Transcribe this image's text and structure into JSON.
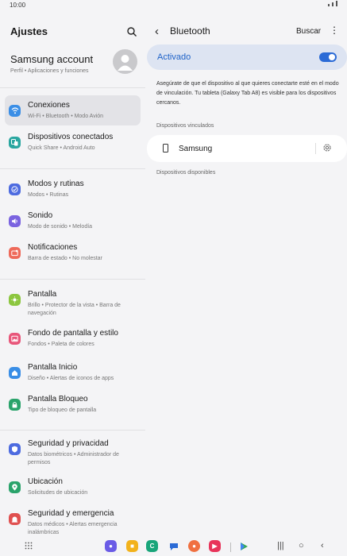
{
  "status_bar": {
    "time": "10:00"
  },
  "left": {
    "title": "Ajustes",
    "account": {
      "name": "Samsung account",
      "sub": "Perfil • Aplicaciones y funciones"
    },
    "items": [
      {
        "title": "Conexiones",
        "sub": "Wi-Fi • Bluetooth • Modo Avión",
        "color": "#3a8ee6",
        "icon": "wifi-icon"
      },
      {
        "title": "Dispositivos conectados",
        "sub": "Quick Share • Android Auto",
        "color": "#2aa6a0",
        "icon": "devices-icon"
      },
      {
        "title": "Modos y rutinas",
        "sub": "Modos • Rutinas",
        "color": "#4d6be0",
        "icon": "check-circle-icon"
      },
      {
        "title": "Sonido",
        "sub": "Modo de sonido • Melodía",
        "color": "#7a63e0",
        "icon": "speaker-icon"
      },
      {
        "title": "Notificaciones",
        "sub": "Barra de estado • No molestar",
        "color": "#ee6a5a",
        "icon": "bell-icon"
      },
      {
        "title": "Pantalla",
        "sub": "Brillo • Protector de la vista • Barra de navegación",
        "color": "#8cc63f",
        "icon": "sun-icon"
      },
      {
        "title": "Fondo de pantalla y estilo",
        "sub": "Fondos • Paleta de colores",
        "color": "#e8567a",
        "icon": "image-icon"
      },
      {
        "title": "Pantalla Inicio",
        "sub": "Diseño • Alertas de iconos de apps",
        "color": "#3a8ee6",
        "icon": "home-icon"
      },
      {
        "title": "Pantalla Bloqueo",
        "sub": "Tipo de bloqueo de pantalla",
        "color": "#2aa36b",
        "icon": "lock-icon"
      },
      {
        "title": "Seguridad y privacidad",
        "sub": "Datos biométricos • Administrador de permisos",
        "color": "#4d6be0",
        "icon": "shield-icon"
      },
      {
        "title": "Ubicación",
        "sub": "Solicitudes de ubicación",
        "color": "#2aa36b",
        "icon": "location-pin-icon"
      },
      {
        "title": "Seguridad y emergencia",
        "sub": "Datos médicos • Alertas emergencia inalámbricas",
        "color": "#e05050",
        "icon": "emergency-icon"
      }
    ]
  },
  "right": {
    "title": "Bluetooth",
    "search_label": "Buscar",
    "toggle": {
      "label": "Activado",
      "on": true
    },
    "info": "Asegúrate de que el dispositivo al que quieres conectarte esté en el modo de vinculación. Tu tableta (Galaxy Tab A8) es visible para los dispositivos cercanos.",
    "paired_label": "Dispositivos vinculados",
    "paired_devices": [
      {
        "name": "Samsung"
      }
    ],
    "available_label": "Dispositivos disponibles"
  },
  "dock": {
    "apps": [
      {
        "icon": "messages-bubble-icon",
        "color": "#6a5be6"
      },
      {
        "icon": "folder-icon",
        "color": "#f2b21c"
      },
      {
        "icon": "phone-icon",
        "color": "#19a57a"
      },
      {
        "icon": "chat-icon",
        "color": "#2b6bd6"
      },
      {
        "icon": "contacts-icon",
        "color": "#f07040"
      },
      {
        "icon": "video-icon",
        "color": "#e8345a"
      },
      {
        "icon": "play-store-icon",
        "color": "#34a853"
      }
    ]
  }
}
